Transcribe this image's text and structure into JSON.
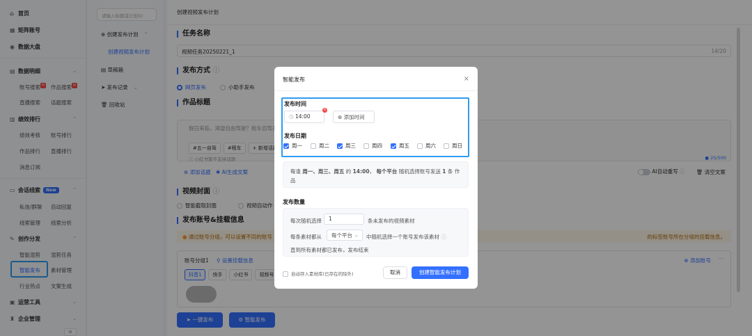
{
  "sidebar": {
    "home": "首页",
    "matrix": "矩阵账号",
    "dashboard": "数据大盘",
    "data_detail": "数据明细",
    "account_search": "账号搜索",
    "works_search": "作品搜索",
    "live_search": "直播搜索",
    "topic_search": "话题搜索",
    "ranking": "绩效排行",
    "perf_check": "绩效考核",
    "account_rank": "账号排行",
    "works_rank": "作品排行",
    "live_rank": "直播排行",
    "msg_sub": "消息订阅",
    "conversation": "会话线索",
    "new_badge": "New",
    "private_msg": "私信/群聊",
    "auto_reply": "自动回复",
    "lead_mgmt": "线索管理",
    "lead_analysis": "线索分析",
    "creation": "创作分发",
    "smart_mix": "智能混剪",
    "mix_task": "混剪任务",
    "smart_publish": "智能发布",
    "material_mgmt": "素材管理",
    "industry_hot": "行业热点",
    "copy_gen": "文案生成",
    "ops_tools": "运营工具",
    "enterprise": "企业管理"
  },
  "panel2": {
    "search_placeholder": "请输入标题或计划ID",
    "create_plan": "创建发布计划",
    "create_video_plan": "创建视频发布计划",
    "draft": "草稿箱",
    "publish_record": "发布记录",
    "recycle": "回收站"
  },
  "main": {
    "header": "创建视频发布计划",
    "task_name_title": "任务名称",
    "task_name_value": "视频任务20250221_1",
    "task_name_count": "14/20",
    "publish_method_title": "发布方式",
    "method_web": "网页发布",
    "method_helper": "小助手发布",
    "works_title_title": "作品标题",
    "title_placeholder": "假日来临，渴望自由驾驶？租车自驾开启...",
    "tag1": "#五一自驾",
    "tag2": "#租车",
    "tag3": "+ 新增话题",
    "xhs_hint": "小红书暂不支持话题",
    "add_topic": "添加话题",
    "ai_copy": "AI生成文案",
    "char_count": "25/500",
    "ai_rewrite": "AI自动重写",
    "clear_copy": "清空文案",
    "cover_title": "视频封面",
    "cover_smart": "智能截取封面",
    "cover_auto": "视频自动作",
    "account_title": "发布账号&挂载信息",
    "warning": "通过账号分组，可以设置不同的账号",
    "warning_right": "的标签账号所在分组的挂载信息。",
    "group_name": "账号分组1",
    "group_setting": "设置挂载信息",
    "add_account": "添加账号",
    "platform_douyin": "抖音1",
    "platform_kuaishou": "快手",
    "platform_xhs": "小红书",
    "platform_shipin": "视频号",
    "btn_one_click": "一键发布",
    "btn_smart_publish": "智能发布"
  },
  "modal": {
    "title": "智能发布",
    "publish_time_label": "发布时间",
    "time_value": "14:00",
    "add_time": "添加时间",
    "publish_date_label": "发布日期",
    "days": [
      "周一",
      "周二",
      "周三",
      "周四",
      "周五",
      "周六",
      "周日"
    ],
    "days_checked": [
      true,
      false,
      true,
      false,
      true,
      false,
      false
    ],
    "summary_pre": "每逢",
    "summary_days": "周一、周三、周五",
    "summary_of": "的",
    "summary_time": "14:00",
    "summary_comma": "，",
    "summary_platform": "每个平台",
    "summary_mid": "随机选择账号发送",
    "summary_count": "1",
    "summary_unit": "条",
    "summary_end": "作品",
    "publish_count_label": "发布数量",
    "each_random": "每次随机选择",
    "each_value": "1",
    "each_suffix": "条未发布的视频素材",
    "each_material_pre": "每条素材都从",
    "platform_select": "每个平台",
    "each_material_post": "中随机选择一个账号发布该素材",
    "until_text": "直到所有素材都已发布，发布结束",
    "auto_store": "自动存入素材库(已存在的除外)",
    "cancel": "取消",
    "create": "创建智能发布计划"
  }
}
